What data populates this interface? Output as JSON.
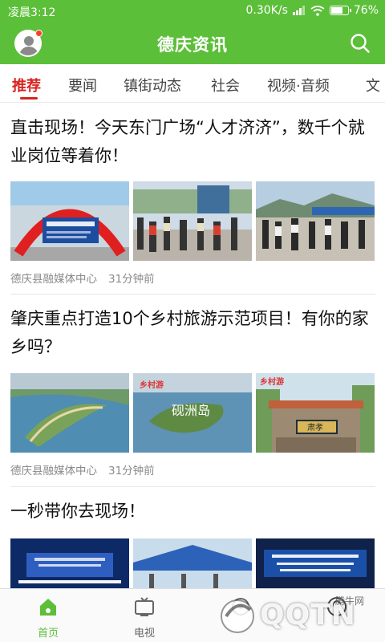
{
  "status_bar": {
    "time": "凌晨3:12",
    "speed": "0.30K/s",
    "battery": "76%",
    "battery_level": 0.76
  },
  "header": {
    "title": "德庆资讯"
  },
  "tabs": [
    {
      "label": "推荐",
      "active": true
    },
    {
      "label": "要闻"
    },
    {
      "label": "镇街动态"
    },
    {
      "label": "社会"
    },
    {
      "label": "视频·音频"
    },
    {
      "label": "文"
    }
  ],
  "articles": [
    {
      "title": "直击现场！今天东门广场“人才济济”，数千个就业岗位等着你！",
      "source": "德庆县融媒体中心",
      "time": "31分钟前"
    },
    {
      "title": "肇庆重点打造10个乡村旅游示范项目！有你的家乡吗？",
      "source": "德庆县融媒体中心",
      "time": "31分钟前",
      "image_texts": [
        "砚洲岛",
        "肃孝"
      ]
    },
    {
      "title": "一秒带你去现场！"
    }
  ],
  "bottom_nav": [
    {
      "label": "首页",
      "icon": "home-icon",
      "active": true
    },
    {
      "label": "电视",
      "icon": "tv-icon"
    },
    {
      "label": "",
      "icon": "broadcast-icon"
    },
    {
      "label": "",
      "icon": "profile-icon"
    }
  ],
  "watermark": {
    "text": "QQTN",
    "small": "腾牛网"
  },
  "colors": {
    "brand_green": "#5cbf39",
    "tab_active_red": "#d8241f"
  }
}
